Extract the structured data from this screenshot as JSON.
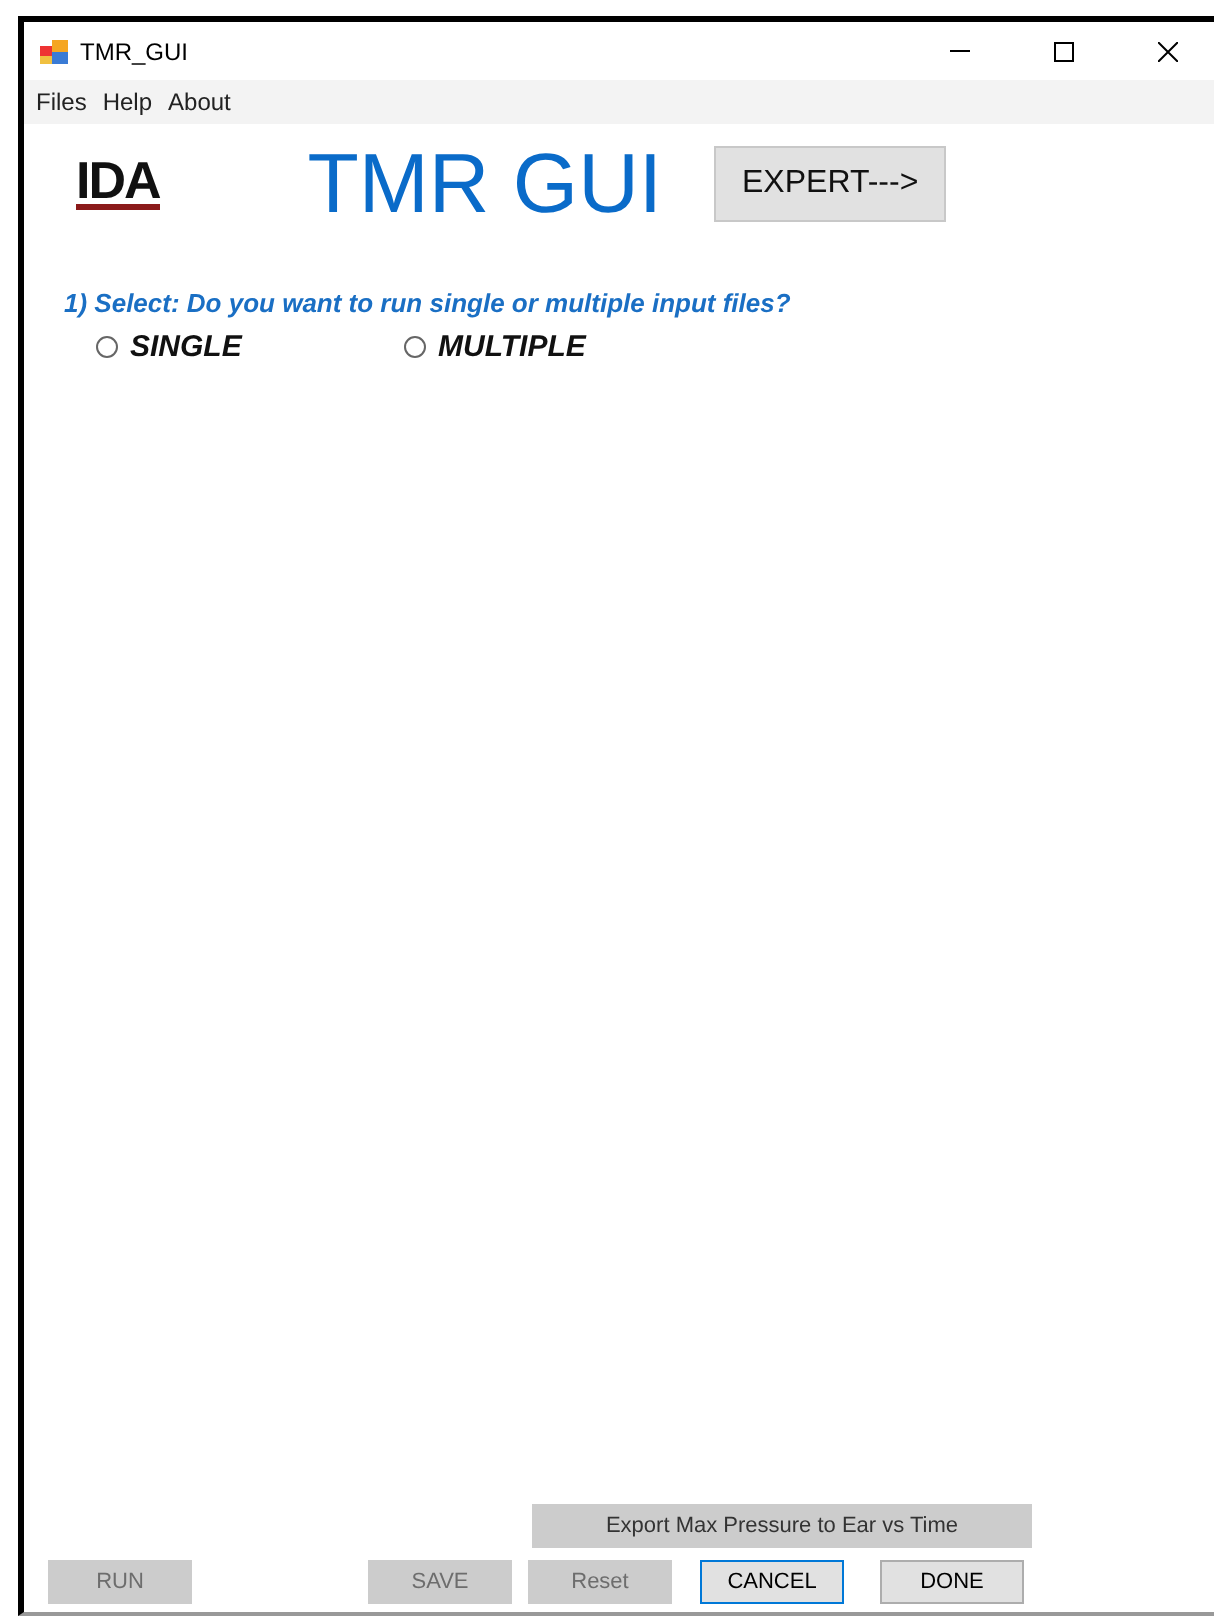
{
  "window": {
    "title": "TMR_GUI"
  },
  "menu": [
    "Files",
    "Help",
    "About"
  ],
  "logo": "IDA",
  "app_title": "TMR GUI",
  "expert_button": {
    "label": "EXPERT--->",
    "disabled": false
  },
  "question": "1) Select: Do you want to run single or multiple input files?",
  "options": [
    {
      "label": "SINGLE",
      "selected": false
    },
    {
      "label": "MULTIPLE",
      "selected": false
    }
  ],
  "export_button": {
    "label": "Export Max Pressure to Ear vs Time",
    "disabled": true
  },
  "buttons": [
    {
      "label": "RUN",
      "disabled": true,
      "focused": false
    },
    {
      "label": "SAVE",
      "disabled": true,
      "focused": false
    },
    {
      "label": "Reset",
      "disabled": true,
      "focused": false
    },
    {
      "label": "CANCEL",
      "disabled": false,
      "focused": true
    },
    {
      "label": "DONE",
      "disabled": false,
      "focused": false
    }
  ]
}
